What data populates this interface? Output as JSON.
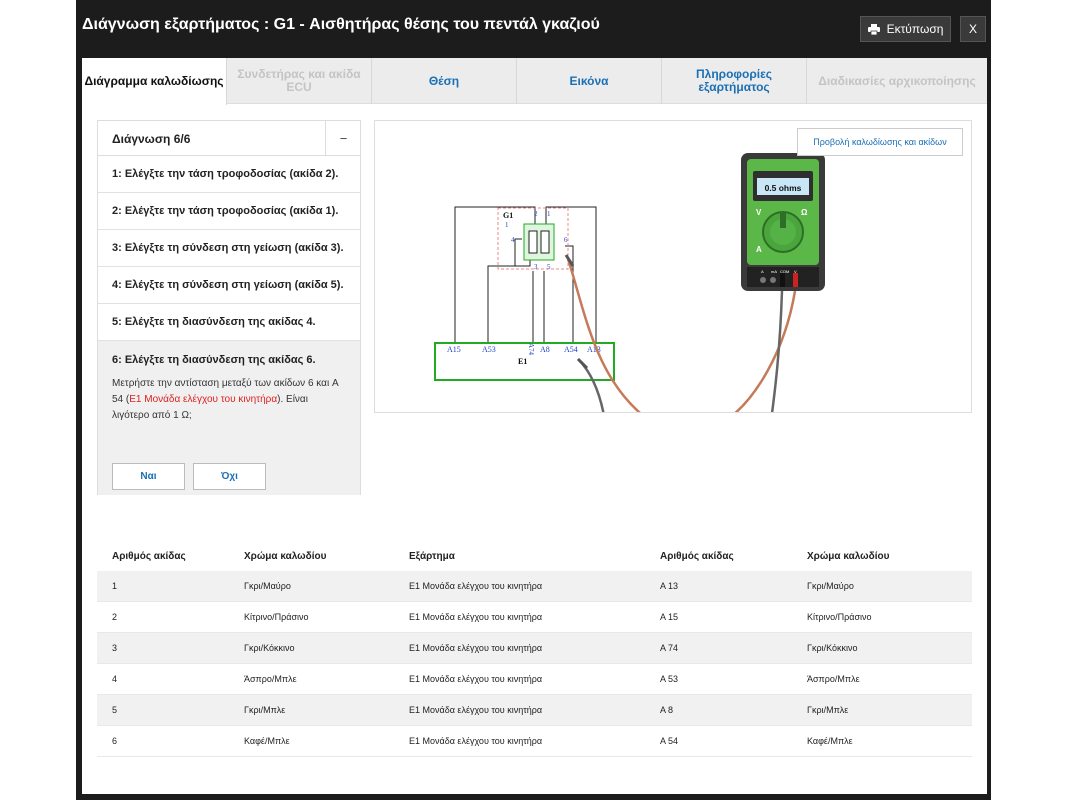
{
  "title": "Διάγνωση εξαρτήματος : G1 - Αισθητήρας θέσης του πεντάλ γκαζιού",
  "print_label": "Εκτύπωση",
  "close_label": "X",
  "tabs": [
    {
      "label": "Διάγραμμα καλωδίωσης",
      "state": "active"
    },
    {
      "label": "Συνδετήρας και ακίδα ECU",
      "state": "disabled"
    },
    {
      "label": "Θέση",
      "state": "normal"
    },
    {
      "label": "Εικόνα",
      "state": "normal"
    },
    {
      "label": "Πληροφορίες εξαρτήματος",
      "state": "normal"
    },
    {
      "label": "Διαδικασίες αρχικοποίησης",
      "state": "disabled"
    }
  ],
  "diagnosis": {
    "title": "Διάγνωση 6/6",
    "collapse_symbol": "−",
    "steps": [
      "1: Ελέγξτε την τάση τροφοδοσίας (ακίδα 2).",
      "2: Ελέγξτε την τάση τροφοδοσίας (ακίδα 1).",
      "3: Ελέγξτε τη σύνδεση στη γείωση (ακίδα 3).",
      "4: Ελέγξτε τη σύνδεση στη γείωση (ακίδα 5).",
      "5: Ελέγξτε τη διασύνδεση της ακίδας 4."
    ],
    "active_step": {
      "title": "6: Ελέγξτε τη διασύνδεση της ακίδας 6.",
      "desc_before": "Μετρήστε την αντίσταση μεταξύ των ακίδων 6 και A 54 (",
      "desc_link": "E1 Μονάδα ελέγχου του κινητήρα",
      "desc_after": "). Είναι λιγότερο από 1 Ω;",
      "yes_label": "Ναι",
      "no_label": "Όχι"
    }
  },
  "diagram": {
    "wiring_button": "Προβολή καλωδίωσης και ακίδων",
    "component_label": "G1",
    "ecu_label": "E1",
    "meter_reading": "0.5 ohms",
    "g1_pins": [
      "1",
      "2",
      "3",
      "4",
      "5",
      "6"
    ],
    "ecu_pins": [
      "A15",
      "A53",
      "A74",
      "A8",
      "A54",
      "A13"
    ],
    "meter_modes": [
      "V",
      "Ω",
      "A"
    ],
    "meter_jacks": [
      "A",
      "mA",
      "COM",
      "V"
    ],
    "colors": {
      "ecu_box": "#22aa22",
      "g1_box": "#e88",
      "probe_wire": "#c57a5a",
      "meter_body": "#3a3a3a",
      "meter_face": "#5bb848",
      "meter_lcd": "#c8e6f5"
    }
  },
  "table": {
    "headers": [
      "Αριθμός ακίδας",
      "Χρώμα καλωδίου",
      "Εξάρτημα",
      "Αριθμός ακίδας",
      "Χρώμα καλωδίου"
    ],
    "rows": [
      [
        "1",
        "Γκρι/Μαύρο",
        "E1 Μονάδα ελέγχου του κινητήρα",
        "A 13",
        "Γκρι/Μαύρο"
      ],
      [
        "2",
        "Κίτρινο/Πράσινο",
        "E1 Μονάδα ελέγχου του κινητήρα",
        "A 15",
        "Κίτρινο/Πράσινο"
      ],
      [
        "3",
        "Γκρι/Κόκκινο",
        "E1 Μονάδα ελέγχου του κινητήρα",
        "A 74",
        "Γκρι/Κόκκινο"
      ],
      [
        "4",
        "Άσπρο/Μπλε",
        "E1 Μονάδα ελέγχου του κινητήρα",
        "A 53",
        "Άσπρο/Μπλε"
      ],
      [
        "5",
        "Γκρι/Μπλε",
        "E1 Μονάδα ελέγχου του κινητήρα",
        "A 8",
        "Γκρι/Μπλε"
      ],
      [
        "6",
        "Καφέ/Μπλε",
        "E1 Μονάδα ελέγχου του κινητήρα",
        "A 54",
        "Καφέ/Μπλε"
      ]
    ]
  }
}
